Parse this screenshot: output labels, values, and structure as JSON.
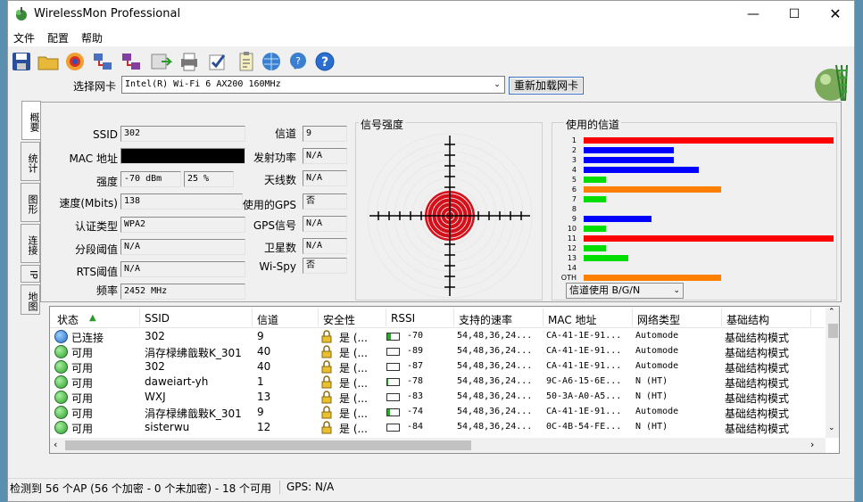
{
  "window": {
    "title": "WirelessMon Professional"
  },
  "menu": [
    "文件",
    "配置",
    "帮助"
  ],
  "adapter": {
    "label": "选择网卡",
    "value": "Intel(R) Wi-Fi 6 AX200 160MHz",
    "reload_label": "重新加载网卡"
  },
  "tabs": [
    "概要",
    "统计",
    "图形",
    "连接",
    "IP",
    "地图"
  ],
  "summary": {
    "ssid_label": "SSID",
    "ssid": "302",
    "mac_label": "MAC 地址",
    "mac": "",
    "strength_label": "强度",
    "strength_dbm": "-70 dBm",
    "strength_pct": "25 %",
    "speed_label": "速度(Mbits)",
    "speed": "138",
    "auth_label": "认证类型",
    "auth": "WPA2",
    "frag_label": "分段阈值",
    "frag": "N/A",
    "rts_label": "RTS阈值",
    "rts": "N/A",
    "freq_label": "频率",
    "freq": "2452 MHz",
    "channel_label": "信道",
    "channel": "9",
    "txpower_label": "发射功率",
    "txpower": "N/A",
    "antenna_label": "天线数",
    "antenna": "N/A",
    "gps_used_label": "使用的GPS",
    "gps_used": "否",
    "gps_signal_label": "GPS信号",
    "gps_signal": "N/A",
    "satellite_label": "卫星数",
    "satellite": "N/A",
    "wispy_label": "Wi-Spy",
    "wispy": "否"
  },
  "signal": {
    "title": "信号强度"
  },
  "channels": {
    "title": "使用的信道",
    "labels": [
      "1",
      "2",
      "3",
      "4",
      "5",
      "6",
      "7",
      "8",
      "9",
      "10",
      "11",
      "12",
      "13",
      "14",
      "OTH"
    ],
    "usage": [
      1.0,
      0.36,
      0.36,
      0.46,
      0.09,
      0.55,
      0.09,
      0.0,
      0.27,
      0.09,
      1.0,
      0.09,
      0.18,
      0.0,
      0.55
    ],
    "colors": [
      "#ff0000",
      "#0000ff",
      "#0000ff",
      "#0000ff",
      "#00dd00",
      "#ff8000",
      "#00dd00",
      "#000000",
      "#0000ff",
      "#00dd00",
      "#ff0000",
      "#00dd00",
      "#00dd00",
      "#000000",
      "#ff8000"
    ],
    "mode_value": "信道使用 B/G/N"
  },
  "list": {
    "headers": [
      "状态",
      "SSID",
      "信道",
      "安全性",
      "RSSI",
      "支持的速率",
      "MAC 地址",
      "网络类型",
      "基础结构"
    ],
    "rows": [
      {
        "status": "已连接",
        "ssid": "302",
        "channel": "9",
        "security": "是 (...",
        "rssi": "-70",
        "rssi_level": 0.3,
        "rates": "54,48,36,24...",
        "mac": "CA-41-1E-91...",
        "nettype": "Automode",
        "infra": "基础结构模式",
        "connected": true
      },
      {
        "status": "可用",
        "ssid": "涓存椂绋戠敤K_301",
        "channel": "40",
        "security": "是 (...",
        "rssi": "-89",
        "rssi_level": 0.0,
        "rates": "54,48,36,24...",
        "mac": "CA-41-1E-91...",
        "nettype": "Automode",
        "infra": "基础结构模式",
        "connected": false
      },
      {
        "status": "可用",
        "ssid": "302",
        "channel": "40",
        "security": "是 (...",
        "rssi": "-87",
        "rssi_level": 0.0,
        "rates": "54,48,36,24...",
        "mac": "CA-41-1E-91...",
        "nettype": "Automode",
        "infra": "基础结构模式",
        "connected": false
      },
      {
        "status": "可用",
        "ssid": "daweiart-yh",
        "channel": "1",
        "security": "是 (...",
        "rssi": "-78",
        "rssi_level": 0.1,
        "rates": "54,48,36,24...",
        "mac": "9C-A6-15-6E...",
        "nettype": "N (HT)",
        "infra": "基础结构模式",
        "connected": false
      },
      {
        "status": "可用",
        "ssid": "WXJ",
        "channel": "13",
        "security": "是 (...",
        "rssi": "-83",
        "rssi_level": 0.0,
        "rates": "54,48,36,24...",
        "mac": "50-3A-A0-A5...",
        "nettype": "N (HT)",
        "infra": "基础结构模式",
        "connected": false
      },
      {
        "status": "可用",
        "ssid": "涓存椂绋戠敤K_301",
        "channel": "9",
        "security": "是 (...",
        "rssi": "-74",
        "rssi_level": 0.2,
        "rates": "54,48,36,24...",
        "mac": "CA-41-1E-91...",
        "nettype": "Automode",
        "infra": "基础结构模式",
        "connected": false
      },
      {
        "status": "可用",
        "ssid": "sisterwu",
        "channel": "12",
        "security": "是 (...",
        "rssi": "-84",
        "rssi_level": 0.0,
        "rates": "54,48,36,24...",
        "mac": "0C-4B-54-FE...",
        "nettype": "N (HT)",
        "infra": "基础结构模式",
        "connected": false
      }
    ]
  },
  "status": {
    "left": "检测到 56 个AP (56 个加密 - 0 个未加密) - 18 个可用",
    "gps": "GPS: N/A"
  }
}
